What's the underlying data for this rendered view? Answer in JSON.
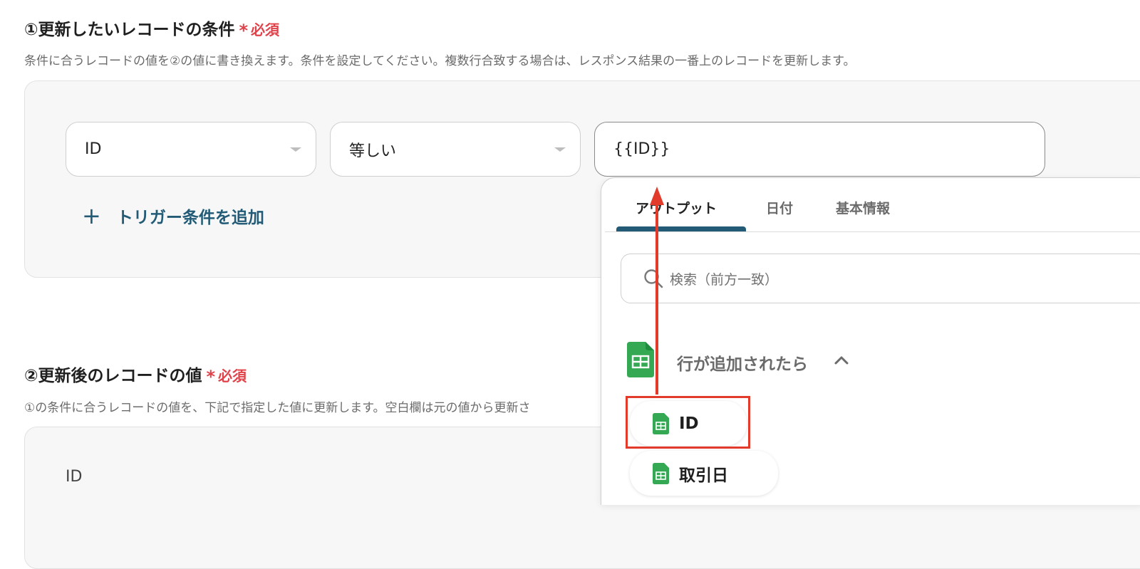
{
  "section1": {
    "title": "①更新したいレコードの条件",
    "required_mark": "*",
    "required_label": "必須",
    "description": "条件に合うレコードの値を②の値に書き換えます。条件を設定してください。複数行合致する場合は、レスポンス結果の一番上のレコードを更新します。"
  },
  "condition": {
    "field_value": "ID",
    "operator_value": "等しい",
    "value_input": "{{ID}}",
    "add_trigger_plus": "+",
    "add_trigger_label": "トリガー条件を追加"
  },
  "section2": {
    "title": "②更新後のレコードの値",
    "required_mark": "*",
    "required_label": "必須",
    "description": "①の条件に合うレコードの値を、下記で指定した値に更新します。空白欄は元の値から更新さ",
    "first_field_label": "ID"
  },
  "dropdown": {
    "tabs": [
      {
        "label": "アウトプット",
        "active": true
      },
      {
        "label": "日付",
        "active": false
      },
      {
        "label": "基本情報",
        "active": false
      }
    ],
    "search_placeholder": "検索（前方一致）",
    "group_label": "行が追加されたら",
    "items": [
      {
        "label": "ID",
        "highlighted": true
      },
      {
        "label": "取引日",
        "highlighted": false
      }
    ]
  },
  "colors": {
    "accent": "#235b77",
    "required": "#e0424a",
    "highlight": "#e23b2c",
    "sheets_green": "#34a853"
  }
}
